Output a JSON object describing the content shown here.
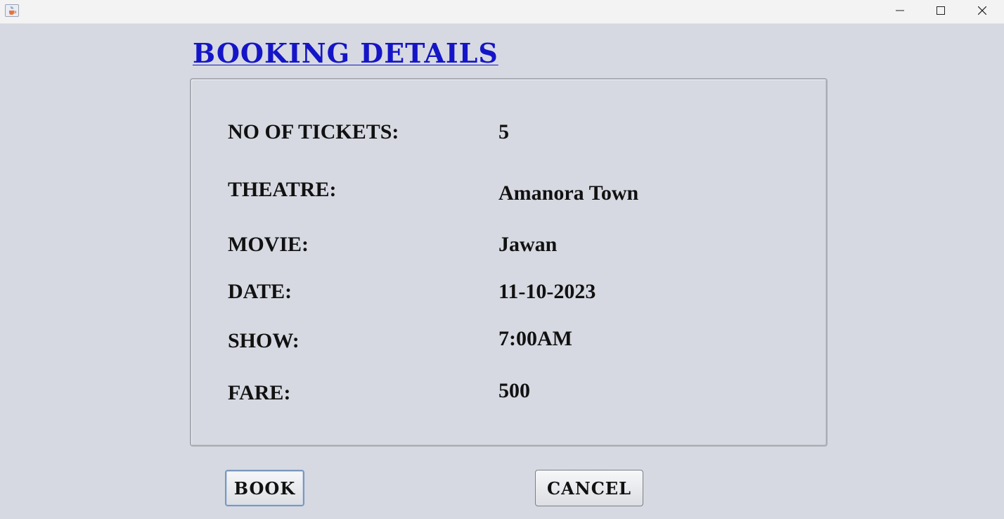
{
  "window": {
    "icon": "java-cup-icon",
    "controls": {
      "minimize": "minimize-icon",
      "maximize": "maximize-icon",
      "close": "close-icon"
    }
  },
  "heading": "BOOKING DETAILS",
  "details": {
    "tickets": {
      "label": "NO OF TICKETS:",
      "value": "5"
    },
    "theatre": {
      "label": "THEATRE:",
      "value": "Amanora Town"
    },
    "movie": {
      "label": "MOVIE:",
      "value": "Jawan"
    },
    "date": {
      "label": "DATE:",
      "value": "11-10-2023"
    },
    "show": {
      "label": "SHOW:",
      "value": "7:00AM"
    },
    "fare": {
      "label": "FARE:",
      "value": "500"
    }
  },
  "buttons": {
    "book": "BOOK",
    "cancel": "CANCEL"
  },
  "colors": {
    "heading": "#1515c8",
    "background": "#d6d9e1",
    "titlebar": "#f3f3f3"
  }
}
